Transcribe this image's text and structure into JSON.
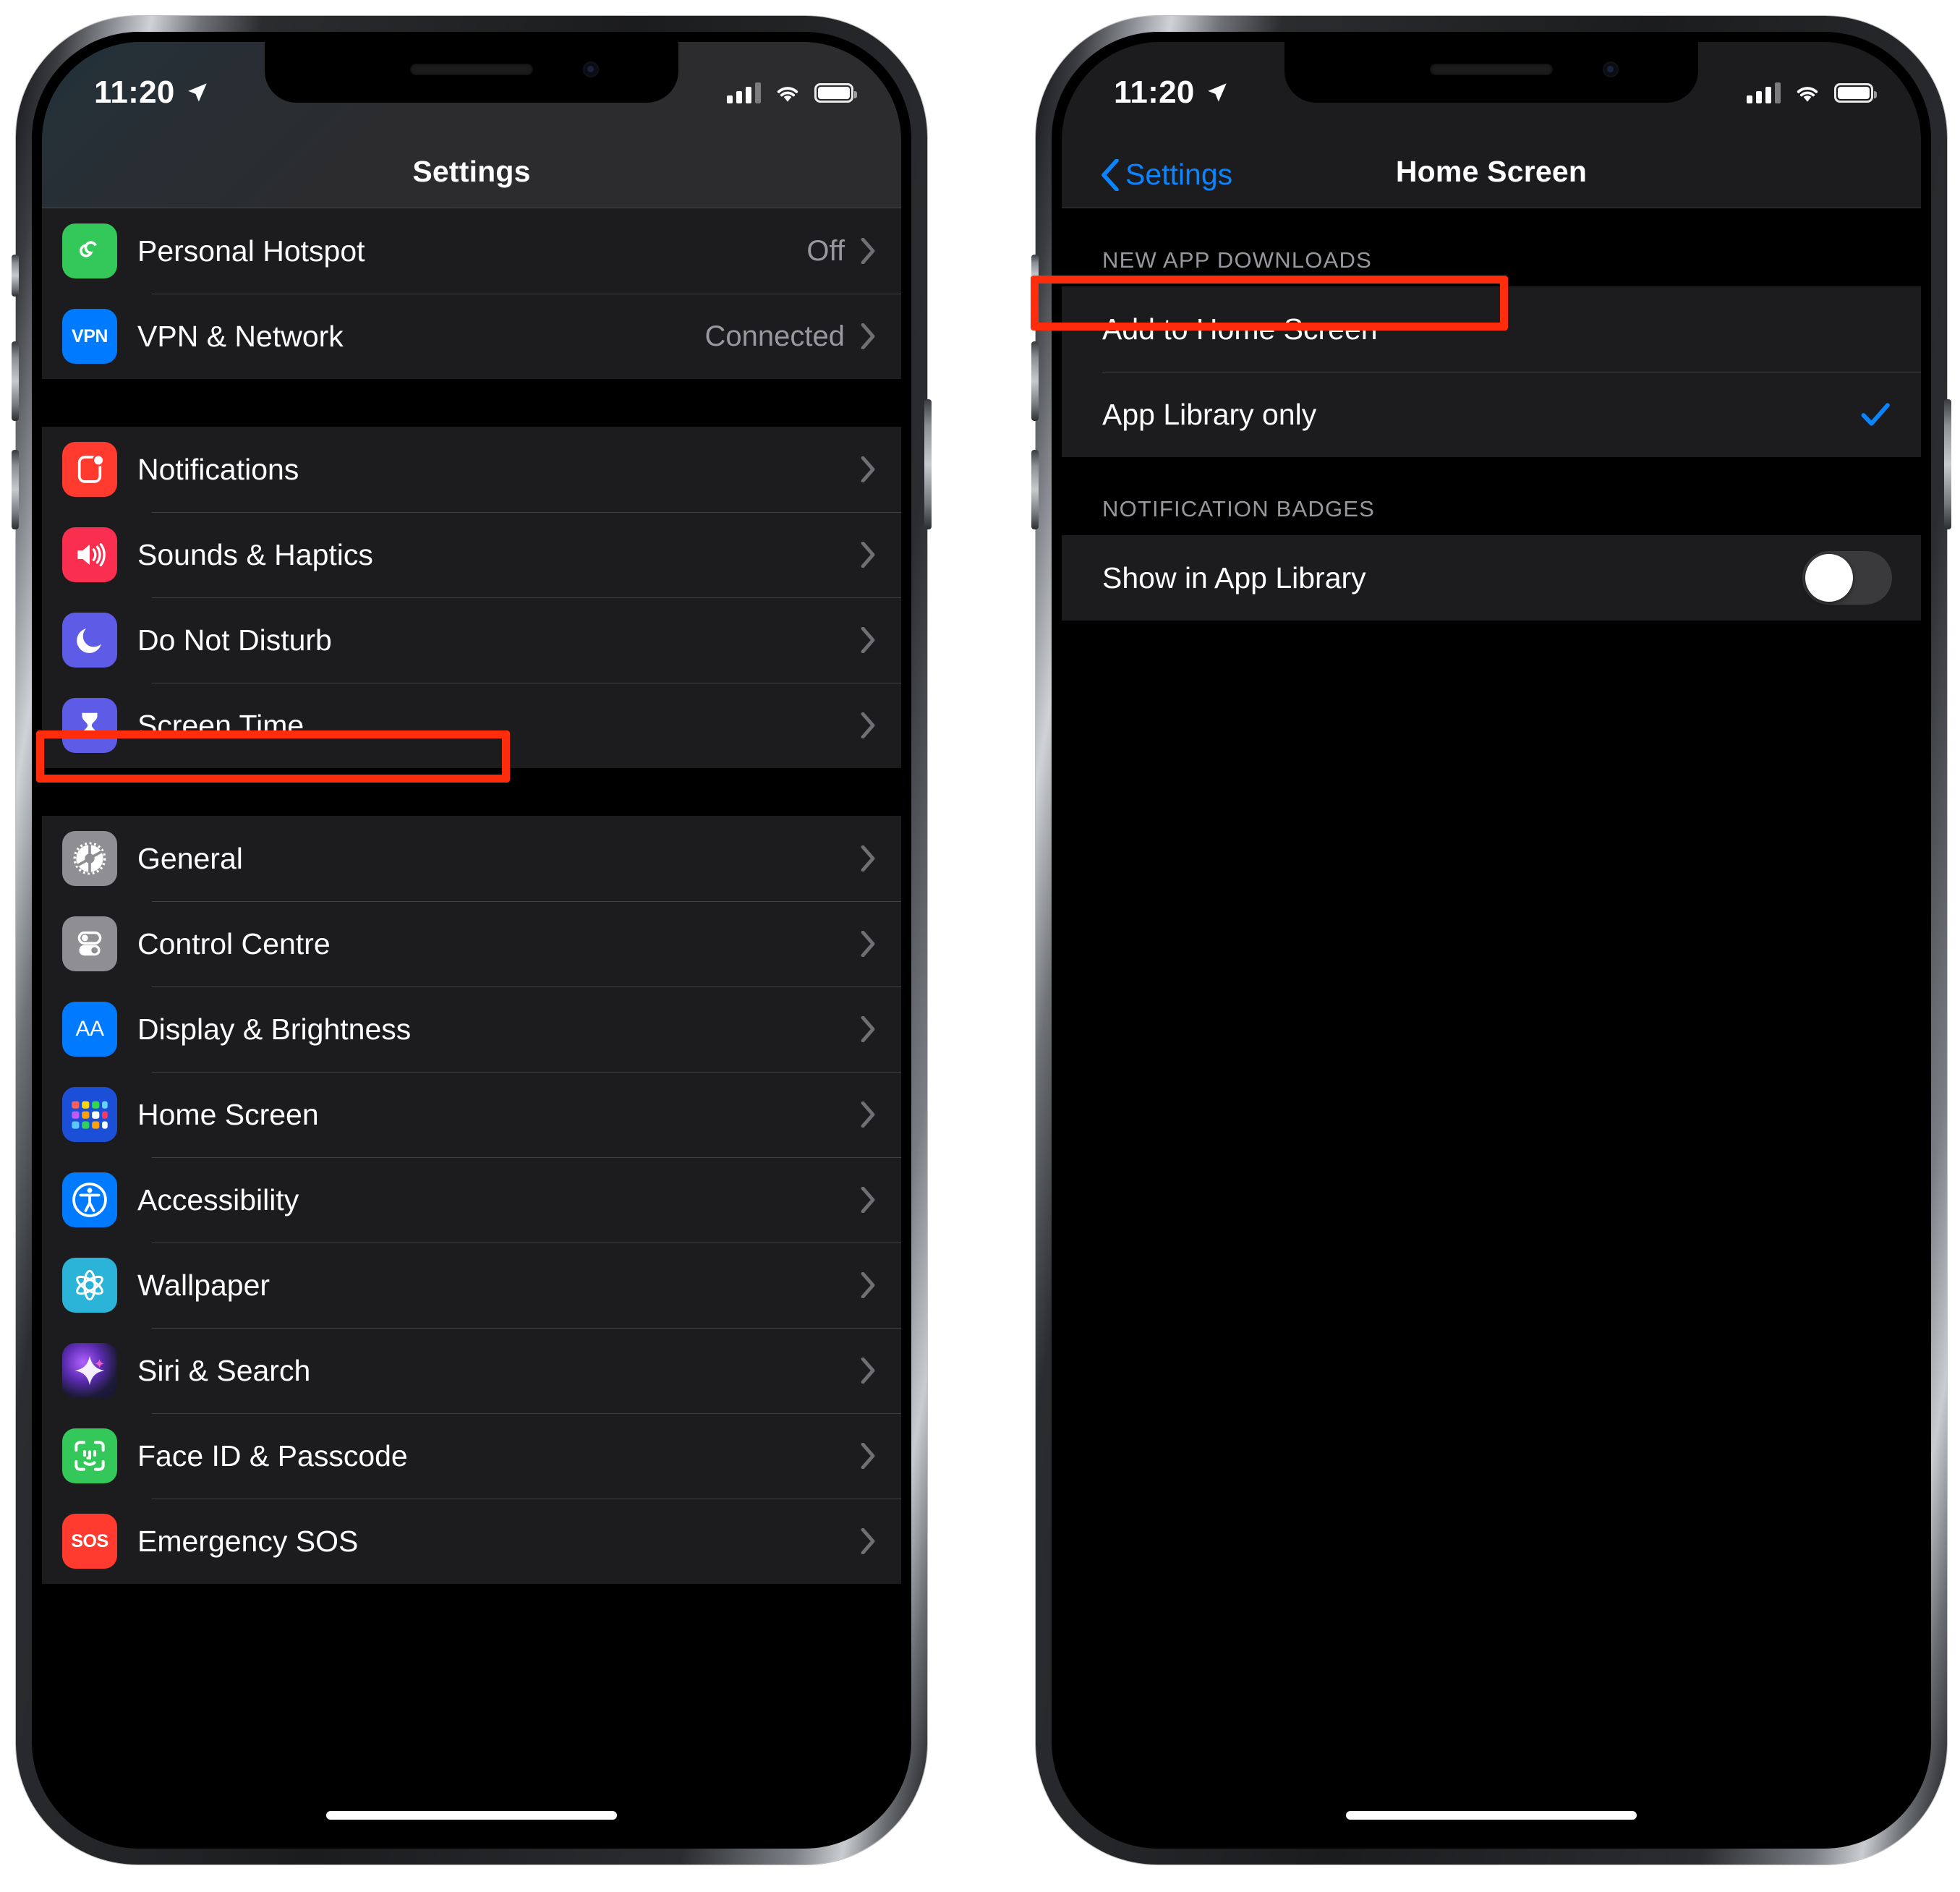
{
  "statusbar": {
    "time": "11:20",
    "location_icon": "location-arrow-icon",
    "signal_icon": "cellular-signal-icon",
    "wifi_icon": "wifi-icon",
    "battery_icon": "battery-icon"
  },
  "phone_left": {
    "nav": {
      "title": "Settings"
    },
    "group1": [
      {
        "label": "Personal Hotspot",
        "value": "Off",
        "icon": "personal-hotspot-icon",
        "icon_color": "#34C759"
      },
      {
        "label": "VPN & Network",
        "value": "Connected",
        "icon": "vpn-icon",
        "icon_color": "#007AFF",
        "icon_text": "VPN"
      }
    ],
    "group2": [
      {
        "label": "Notifications",
        "value": "",
        "icon": "notifications-icon",
        "icon_color": "#FF3B30"
      },
      {
        "label": "Sounds & Haptics",
        "value": "",
        "icon": "sounds-icon",
        "icon_color": "#FA2E4E"
      },
      {
        "label": "Do Not Disturb",
        "value": "",
        "icon": "do-not-disturb-icon",
        "icon_color": "#5E5CE6"
      },
      {
        "label": "Screen Time",
        "value": "",
        "icon": "screen-time-icon",
        "icon_color": "#5E5CE6"
      }
    ],
    "group3": [
      {
        "label": "General",
        "value": "",
        "icon": "general-gear-icon",
        "icon_color": "#8E8E93"
      },
      {
        "label": "Control Centre",
        "value": "",
        "icon": "control-centre-icon",
        "icon_color": "#8E8E93"
      },
      {
        "label": "Display & Brightness",
        "value": "",
        "icon": "display-brightness-icon",
        "icon_color": "#007AFF",
        "icon_text": "AA"
      },
      {
        "label": "Home Screen",
        "value": "",
        "icon": "home-screen-icon",
        "icon_color": "#1C4FD8"
      },
      {
        "label": "Accessibility",
        "value": "",
        "icon": "accessibility-icon",
        "icon_color": "#007AFF"
      },
      {
        "label": "Wallpaper",
        "value": "",
        "icon": "wallpaper-icon",
        "icon_color": "#2CB4D8"
      },
      {
        "label": "Siri & Search",
        "value": "",
        "icon": "siri-icon",
        "icon_color": "#2B2B4E"
      },
      {
        "label": "Face ID & Passcode",
        "value": "",
        "icon": "face-id-icon",
        "icon_color": "#34C759"
      },
      {
        "label": "Emergency SOS",
        "value": "",
        "icon": "emergency-sos-icon",
        "icon_color": "#FF3B30",
        "icon_text": "SOS"
      }
    ]
  },
  "phone_right": {
    "nav": {
      "back_label": "Settings",
      "title": "Home Screen",
      "back_icon": "chevron-left-icon"
    },
    "section1": {
      "header": "NEW APP DOWNLOADS",
      "rows": [
        {
          "label": "Add to Home Screen",
          "selected": false
        },
        {
          "label": "App Library only",
          "selected": true
        }
      ]
    },
    "section2": {
      "header": "NOTIFICATION BADGES",
      "rows": [
        {
          "label": "Show in App Library",
          "toggle": "off"
        }
      ]
    }
  },
  "highlights": {
    "home_screen_row": "home-screen-row-highlight",
    "app_library_row": "app-library-only-row-highlight",
    "color": "#FF2D0C"
  },
  "colors": {
    "accent_blue": "#0A84FF",
    "row_bg": "#1C1C1E",
    "page_bg": "#000000",
    "secondary_text": "#98989E"
  }
}
